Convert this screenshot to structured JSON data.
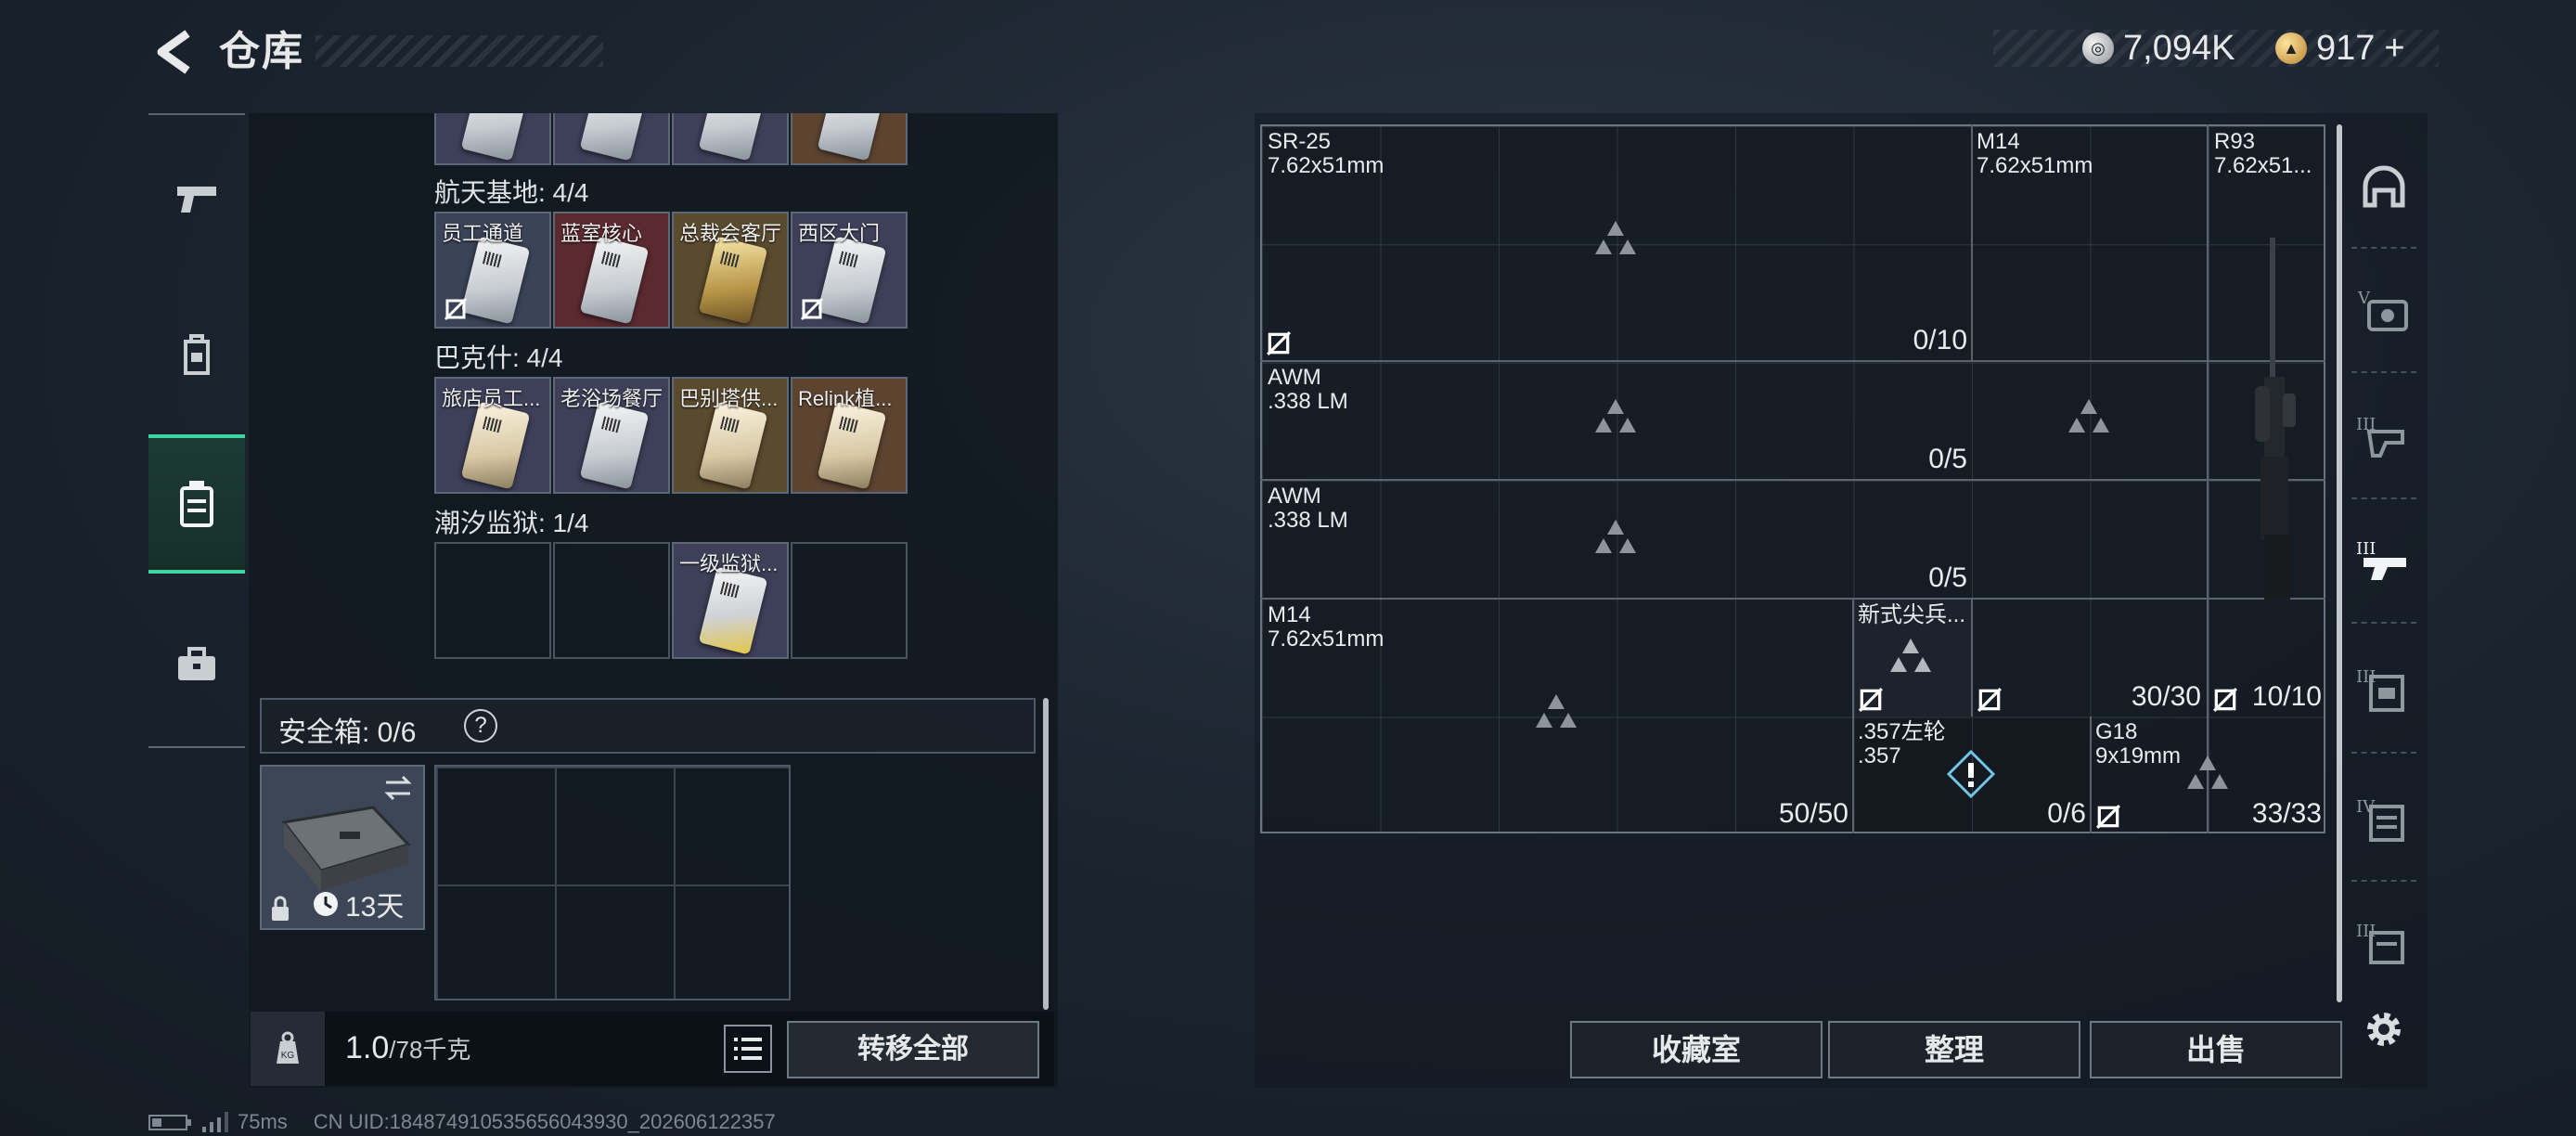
{
  "header": {
    "title": "仓库",
    "currency": [
      {
        "icon": "silver-coin-icon",
        "value": "7,094K"
      },
      {
        "icon": "gold-coin-icon",
        "value": "917"
      }
    ],
    "add_label": "+"
  },
  "left_tabs": [
    {
      "icon": "pistol-icon",
      "active": false
    },
    {
      "icon": "backpack-icon",
      "active": false
    },
    {
      "icon": "keycard-case-icon",
      "active": true
    },
    {
      "icon": "toolbox-icon",
      "active": false
    }
  ],
  "keycards": {
    "sections": [
      {
        "label": "航天基地: 4/4",
        "cards": [
          {
            "name": "员工通道",
            "bg": "blue"
          },
          {
            "name": "蓝室核心",
            "bg": "red"
          },
          {
            "name": "总裁会客厅",
            "bg": "gold"
          },
          {
            "name": "西区大门",
            "bg": "purple"
          }
        ]
      },
      {
        "label": "巴克什: 4/4",
        "cards": [
          {
            "name": "旅店员工...",
            "bg": "purple"
          },
          {
            "name": "老浴场餐厅",
            "bg": "purple"
          },
          {
            "name": "巴别塔供...",
            "bg": "gold"
          },
          {
            "name": "Relink植...",
            "bg": "orange"
          }
        ]
      },
      {
        "label": "潮汐监狱: 1/4",
        "cards": [
          {
            "name": "",
            "bg": "empty"
          },
          {
            "name": "",
            "bg": "empty"
          },
          {
            "name": "一级监狱...",
            "bg": "purple"
          },
          {
            "name": "",
            "bg": "empty"
          }
        ]
      }
    ]
  },
  "safe_box": {
    "label": "安全箱: 0/6",
    "help": "?",
    "timer": "13天"
  },
  "weight": {
    "current": "1.0",
    "max": "/78千克"
  },
  "transfer_all_label": "转移全部",
  "ammo_slots": [
    {
      "name": "SR-25",
      "caliber": "7.62x51mm",
      "count": "0/10"
    },
    {
      "name": "M14",
      "caliber": "7.62x51mm"
    },
    {
      "name": "R93",
      "caliber": "7.62x51..."
    },
    {
      "name": "AWM",
      "caliber": ".338 LM",
      "count": "0/5"
    },
    {
      "name": "AWM",
      "caliber": ".338 LM",
      "count": "0/5"
    },
    {
      "name": "M14",
      "caliber": "7.62x51mm",
      "count": "50/50"
    },
    {
      "name": "新式尖兵...",
      "caliber": "",
      "count": "30/30"
    },
    {
      "name": "",
      "caliber": "",
      "count": "10/10"
    },
    {
      "name": ".357左轮",
      "caliber": ".357",
      "count": "0/6"
    },
    {
      "name": "G18",
      "caliber": "9x19mm",
      "count": "33/33"
    }
  ],
  "bottom_buttons": {
    "collection": "收藏室",
    "organize": "整理",
    "sell": "出售"
  },
  "right_tabs": [
    "helmet-slot-icon",
    "armor-v-icon",
    "armor-iii-icon",
    "rig-iii-icon",
    "backpack-iii-icon",
    "backpack-iv-icon",
    "pouch-iii-icon"
  ],
  "footer": {
    "ping": "75ms",
    "uid": "CN UID:1848749105356560439​30_202606122357"
  }
}
